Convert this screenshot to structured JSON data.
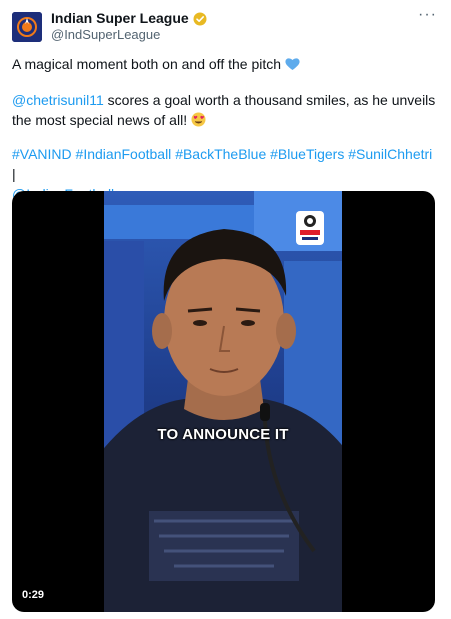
{
  "account": {
    "name": "Indian Super League",
    "handle": "@IndSuperLeague"
  },
  "tweet": {
    "line1": "A magical moment both on and off the pitch",
    "mention": "@chetrisunil11",
    "line2_rest": " scores a goal worth a thousand smiles, as he unveils the most special news of all!",
    "hashtags": [
      "#VANIND",
      "#IndianFootball",
      "#BackTheBlue",
      "#BlueTigers",
      "#SunilChhetri"
    ],
    "separator": "|",
    "trailing_mention": "@IndianFootball"
  },
  "video": {
    "caption": "TO ANNOUNCE IT",
    "timestamp": "0:29"
  },
  "icons": {
    "verified": "verified-badge-icon",
    "more": "more-options-icon",
    "heart": "blue-heart-emoji",
    "face": "heart-eyes-emoji"
  },
  "colors": {
    "link": "#1d9bf0",
    "verified": "#e8b923",
    "secondary_text": "#536471"
  }
}
